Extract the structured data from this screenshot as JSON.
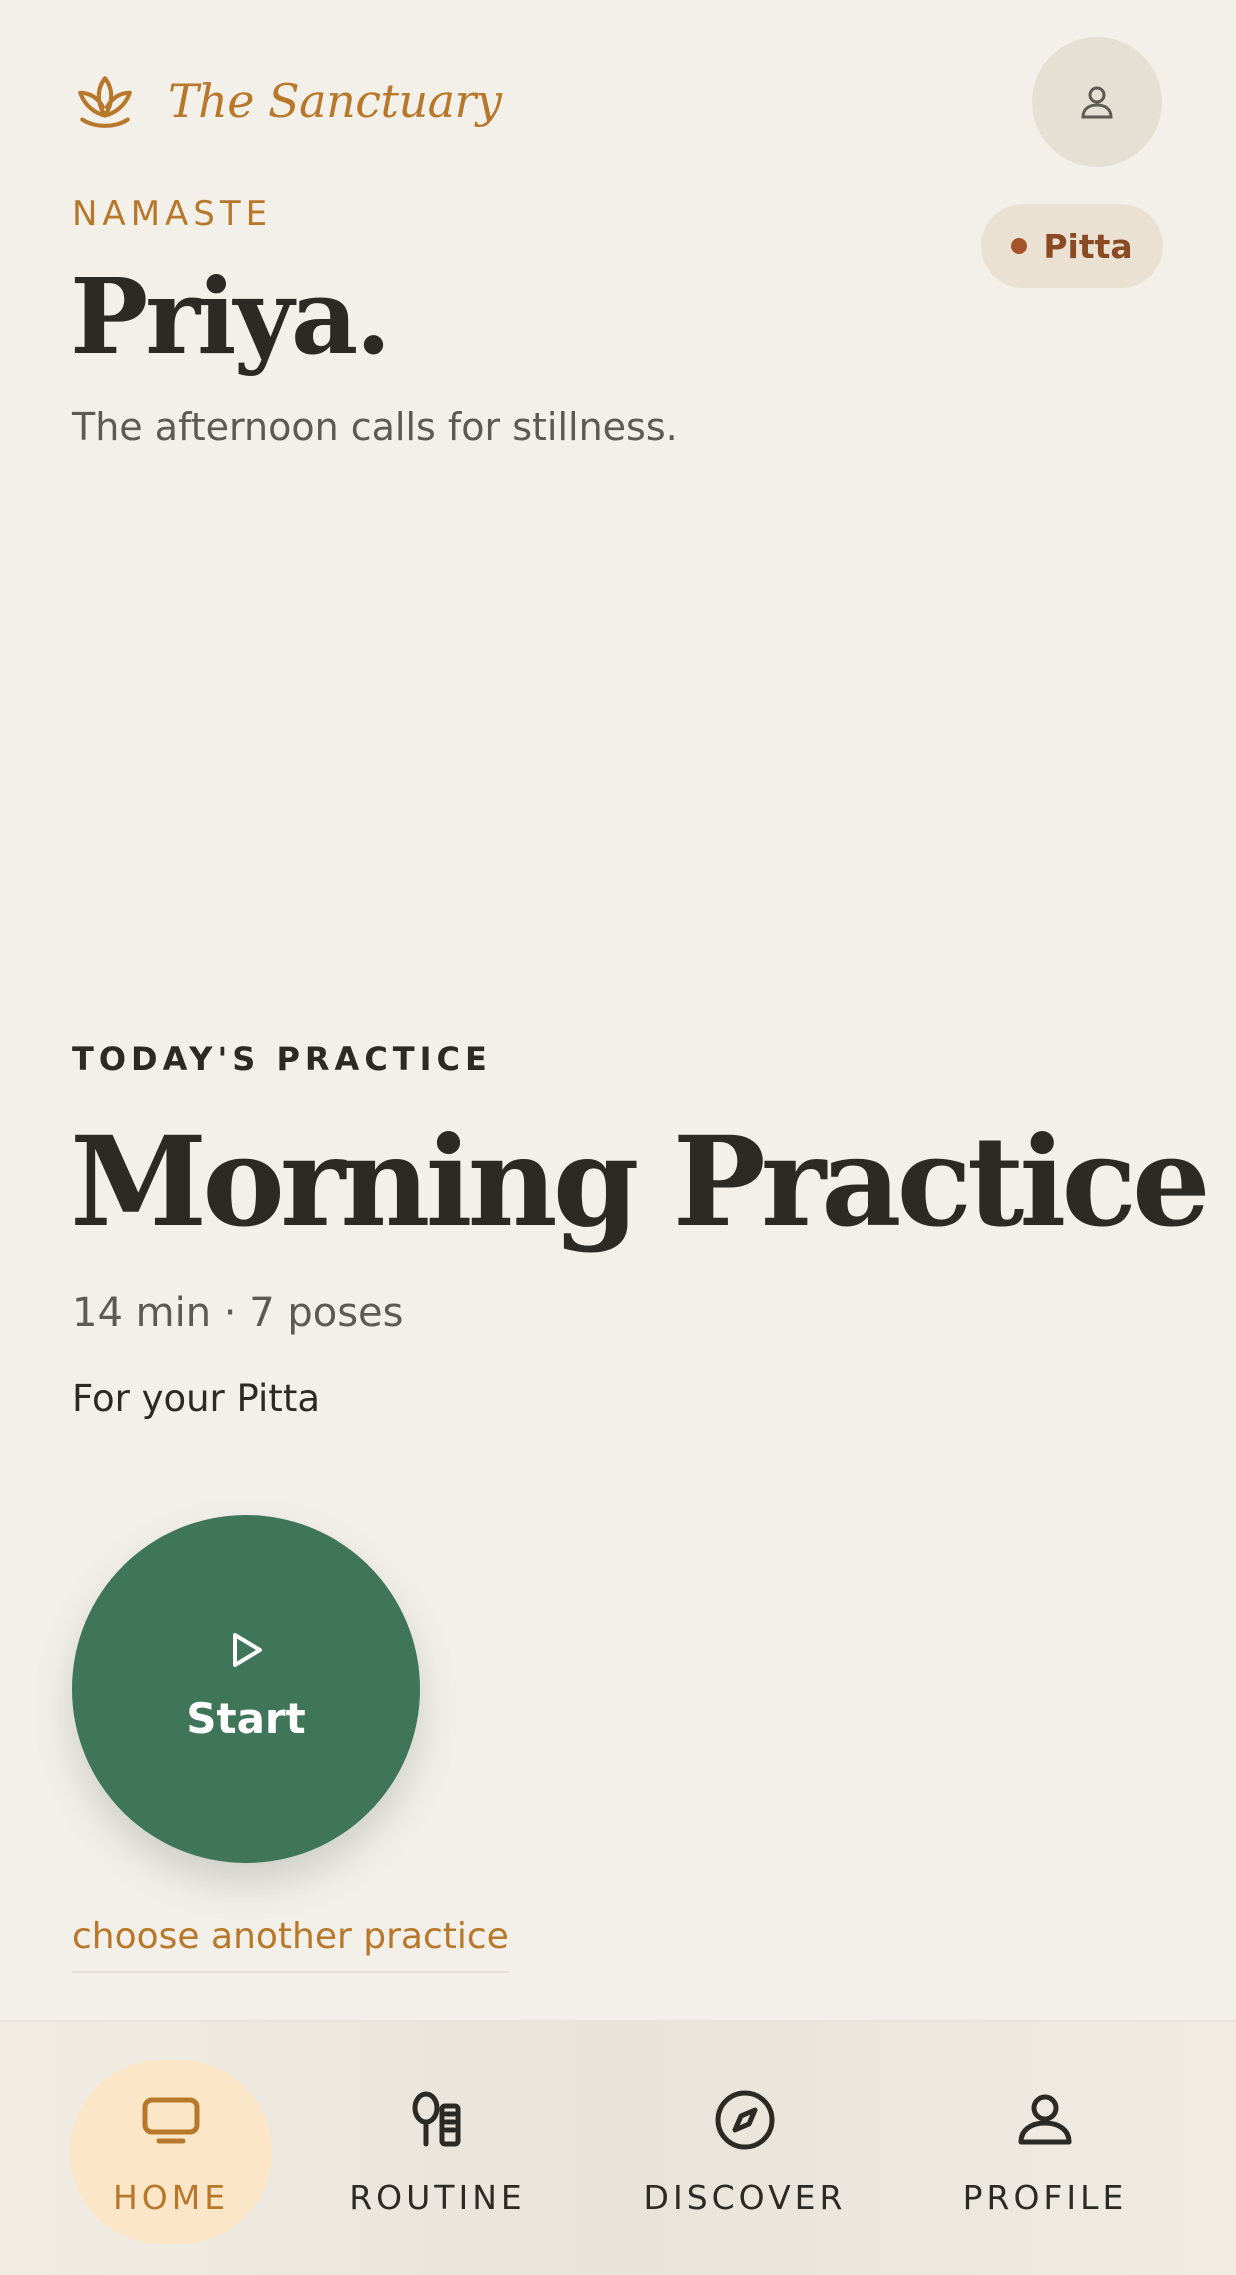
{
  "header": {
    "brand_name": "The Sanctuary",
    "brand_icon": "lotus-icon",
    "account_icon": "person-icon"
  },
  "greeting": {
    "label": "NAMASTE",
    "name": "Priya.",
    "subtitle": "The afternoon calls for stillness."
  },
  "dosha_badge": {
    "label": "Pitta",
    "dot_color": "#a5532a"
  },
  "practice": {
    "section_label": "TODAY'S PRACTICE",
    "title": "Morning Practice",
    "meta": "14 min · 7 poses",
    "for_text": "For your Pitta",
    "start_label": "Start",
    "start_icon": "play-icon",
    "choose_other": "choose another practice"
  },
  "nav": {
    "items": [
      {
        "label": "HOME",
        "icon": "home-icon",
        "active": true
      },
      {
        "label": "ROUTINE",
        "icon": "routine-icon",
        "active": false
      },
      {
        "label": "DISCOVER",
        "icon": "compass-icon",
        "active": false
      },
      {
        "label": "PROFILE",
        "icon": "profile-icon",
        "active": false
      }
    ]
  },
  "colors": {
    "background": "#f3f0e9",
    "accent": "#b8782b",
    "primary_button": "#3f7559",
    "text": "#2b2a24",
    "active_nav": "#fbe6c8"
  }
}
